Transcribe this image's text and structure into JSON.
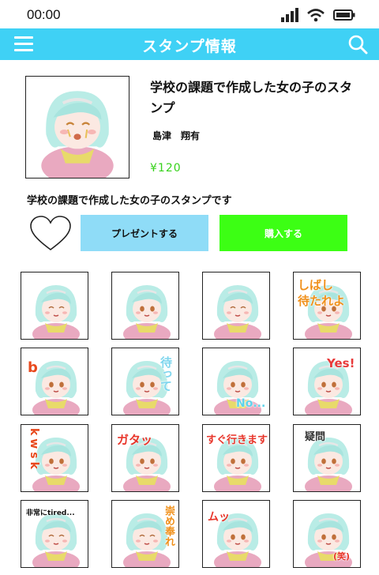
{
  "status": {
    "time": "00:00"
  },
  "header": {
    "title": "スタンプ情報"
  },
  "product": {
    "title": "学校の課題で作成した女の子のスタンプ",
    "author": "島津　翔有",
    "price": "¥120",
    "description": "学校の課題で作成した女の子のスタンプです"
  },
  "actions": {
    "present_label": "プレゼントする",
    "buy_label": "購入する"
  },
  "stickers": [
    {
      "caption": ""
    },
    {
      "caption": ""
    },
    {
      "caption": ""
    },
    {
      "caption": "しばし 待たれよ"
    },
    {
      "caption": "b"
    },
    {
      "caption": "待って"
    },
    {
      "caption": "No..."
    },
    {
      "caption": "Yes!"
    },
    {
      "caption": "kwsk"
    },
    {
      "caption": "ガタッ"
    },
    {
      "caption": "すぐ行きます"
    },
    {
      "caption": "疑問"
    },
    {
      "caption": "非常にtired..."
    },
    {
      "caption": "崇め奉れ"
    },
    {
      "caption": "ムッ"
    },
    {
      "caption": "(笑)"
    }
  ],
  "colors": {
    "header": "#3fd1f5",
    "price": "#37d21b",
    "present_button": "#8fdcf7",
    "buy_button": "#3cff14",
    "hair": "#b9ece6",
    "hoodie": "#e9a9c0",
    "scarf": "#e8da6a"
  }
}
